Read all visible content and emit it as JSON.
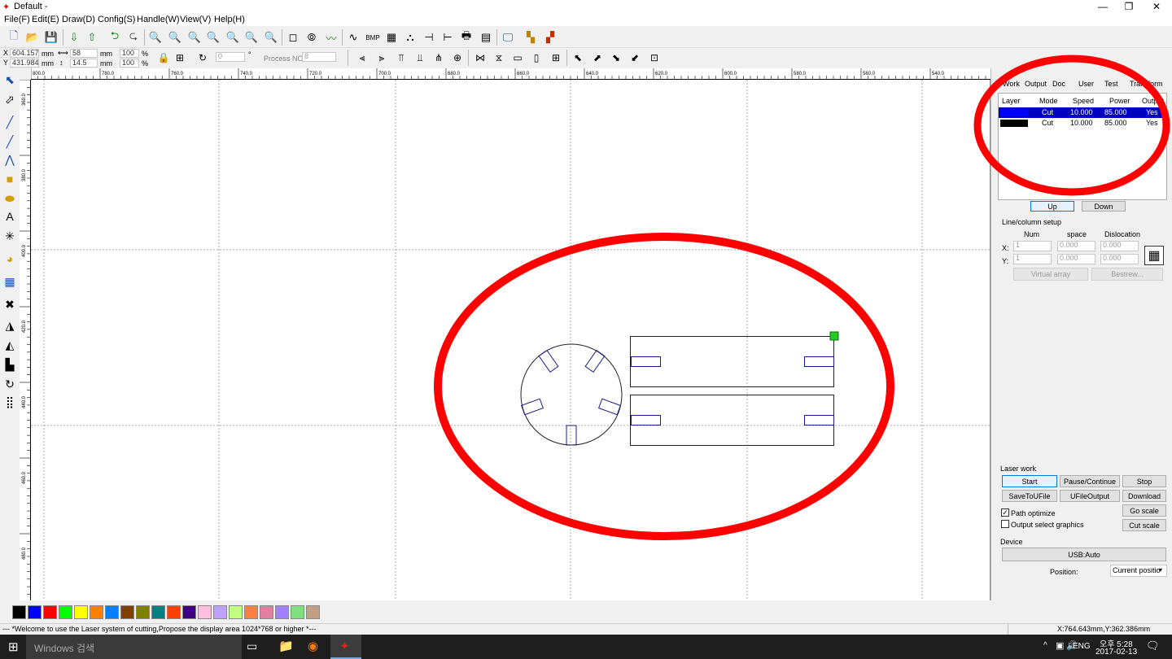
{
  "window": {
    "title": "Default -",
    "minimize": "—",
    "restore": "❐",
    "close": "✕"
  },
  "menu": [
    "File(F)",
    "Edit(E)",
    "Draw(D)",
    "Config(S)",
    "Handle(W)",
    "View(V)",
    "Help(H)"
  ],
  "coords": {
    "x_label": "X",
    "y_label": "Y",
    "x": "604.157",
    "y": "431.984",
    "unit1": "mm",
    "unit2": "mm",
    "width": "58",
    "height": "14.5",
    "wunit": "mm",
    "hunit": "mm",
    "scale_x": "100",
    "scale_y": "100",
    "pct": "%",
    "angle": "0",
    "deg": "°",
    "process_label": "Process NO:",
    "process_no": "8"
  },
  "ruler": {
    "h_labels": [
      "800.0",
      "780.0",
      "760.0",
      "740.0",
      "720.0",
      "700.0",
      "680.0",
      "660.0",
      "640.0",
      "620.0",
      "600.0",
      "580.0",
      "560.0",
      "540.0"
    ],
    "v_labels": [
      "360.0",
      "380.0",
      "400.0",
      "420.0",
      "440.0",
      "460.0",
      "480.0",
      "500.0"
    ]
  },
  "panel": {
    "tabs": [
      "Work",
      "Output",
      "Doc",
      "User",
      "Test",
      "Transform"
    ],
    "table_headers": [
      "Layer",
      "Mode",
      "Speed",
      "Power",
      "Output"
    ],
    "layers": [
      {
        "color": "#0000ff",
        "mode": "Cut",
        "speed": "10.000",
        "power": "85.000",
        "output": "Yes"
      },
      {
        "color": "#000000",
        "mode": "Cut",
        "speed": "10.000",
        "power": "85.000",
        "output": "Yes"
      }
    ],
    "up": "Up",
    "down": "Down",
    "line_setup": "Line/column setup",
    "num": "Num",
    "space": "space",
    "dislocation": "Dislocation",
    "x_lbl": "X:",
    "y_lbl": "Y:",
    "x_num": "1",
    "y_num": "1",
    "x_space": "0.000",
    "y_space": "0.000",
    "x_disl": "0.000",
    "y_disl": "0.000",
    "virtual_array": "Virtual array",
    "bestrew": "Bestrew...",
    "laser_work": "Laser work",
    "start": "Start",
    "pause": "Pause/Continue",
    "stop": "Stop",
    "save_ufile": "SaveToUFile",
    "ufile_output": "UFileOutput",
    "download": "Download",
    "path_optimize": "Path optimize",
    "output_select": "Output select graphics",
    "go_scale": "Go scale",
    "cut_scale": "Cut scale",
    "device": "Device",
    "usb": "USB:Auto",
    "position_lbl": "Position:",
    "position_val": "Current positio"
  },
  "palette": [
    "#000000",
    "#0000ff",
    "#ff0000",
    "#00ff00",
    "#ffff00",
    "#ff8000",
    "#0080ff",
    "#804000",
    "#808000",
    "#008080",
    "#ff4000",
    "#400080",
    "#ffc0e0",
    "#c0a0ff",
    "#c0ff80",
    "#ff8040",
    "#e080a0",
    "#a080ff",
    "#80e080",
    "#c0a080"
  ],
  "status": {
    "message": "--- *Welcome to use the Laser system of cutting,Propose the display area 1024*768 or higher *---",
    "coord": "X:764.643mm,Y:362.386mm"
  },
  "taskbar": {
    "search": "Windows 검색",
    "lang": "ENG",
    "time": "오후 5:28",
    "date": "2017-02-13"
  },
  "colors": {
    "annotation": "#ff0000",
    "shape_stroke": "#222222",
    "slot_stroke": "#1a1a8c",
    "handle": "#22cc22"
  }
}
